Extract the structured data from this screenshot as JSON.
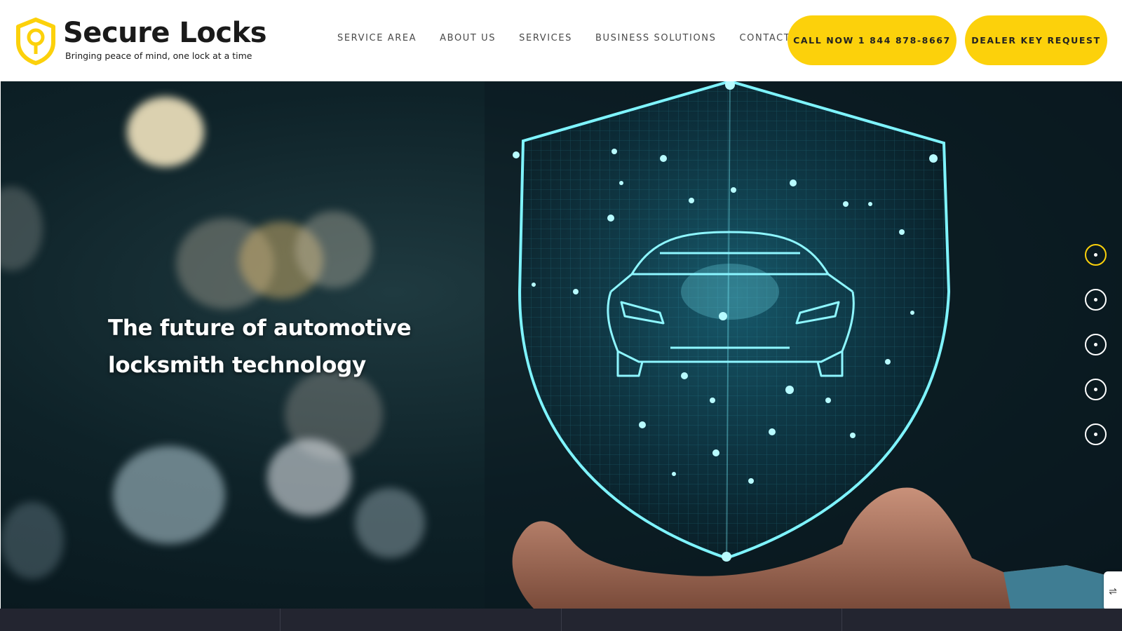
{
  "brand": {
    "name": "Secure Locks",
    "tagline": "Bringing peace of mind, one lock at a time",
    "accent_color": "#fcd10b"
  },
  "nav": {
    "items": [
      {
        "label": "SERVICE AREA"
      },
      {
        "label": "ABOUT US"
      },
      {
        "label": "SERVICES"
      },
      {
        "label": "BUSINESS SOLUTIONS"
      },
      {
        "label": "CONTACT"
      }
    ]
  },
  "cta": {
    "call_label": "CALL NOW 1 844 878-8667",
    "dealer_label": "DEALER KEY REQUEST"
  },
  "hero": {
    "title": "The future of automotive locksmith technology",
    "image_icon": "shield-car-hologram",
    "slides_total": 5,
    "active_slide": 1
  },
  "side_widget": {
    "icon": "accessibility-icon"
  }
}
